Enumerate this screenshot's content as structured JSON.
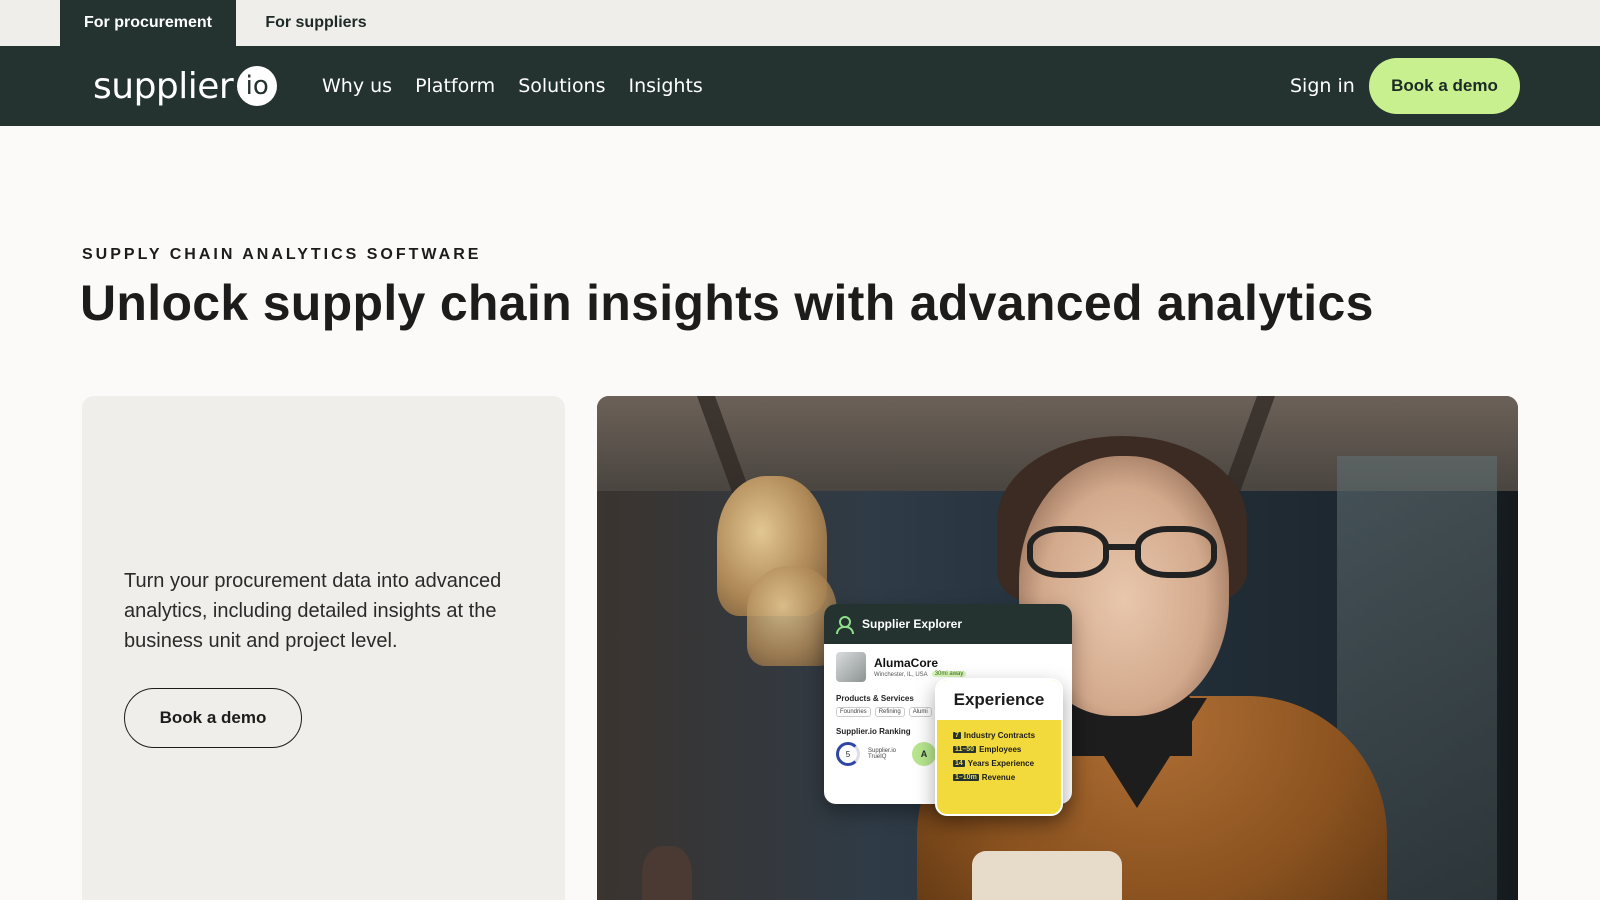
{
  "audience_tabs": [
    {
      "label": "For procurement",
      "active": true
    },
    {
      "label": "For suppliers",
      "active": false
    }
  ],
  "nav": {
    "logo_word": "supplier",
    "logo_badge": "io",
    "links": [
      "Why us",
      "Platform",
      "Solutions",
      "Insights"
    ],
    "sign_in": "Sign in",
    "cta": "Book a demo"
  },
  "hero": {
    "eyebrow": "SUPPLY CHAIN ANALYTICS SOFTWARE",
    "headline": "Unlock supply chain insights with advanced analytics",
    "body": "Turn your procurement data into advanced analytics, including detailed insights at the business unit and project level.",
    "cta": "Book a demo"
  },
  "explorer_card": {
    "title": "Supplier Explorer",
    "supplier_name": "AlumaCore",
    "location": "Winchester, IL, USA",
    "distance": "30mi away",
    "products_heading": "Products & Services",
    "chips": [
      "Foundries",
      "Refining",
      "Alumi"
    ],
    "ranking_heading": "Supplier.io Ranking",
    "rank_score": "5",
    "rank_label": "Supplier.io TrueIQ",
    "rank_grade": "A"
  },
  "experience_card": {
    "title": "Experience",
    "items": [
      {
        "num": "7",
        "label": "Industry Contracts"
      },
      {
        "num": "11–50",
        "label": "Employees"
      },
      {
        "num": "14",
        "label": "Years Experience"
      },
      {
        "num": "1–10m",
        "label": "Revenue"
      }
    ]
  },
  "colors": {
    "nav_bg": "#24332f",
    "cta_green": "#c8f08f",
    "page_bg": "#fcfaf8",
    "card_bg": "#efeeea",
    "experience_yellow": "#f3da3c"
  }
}
